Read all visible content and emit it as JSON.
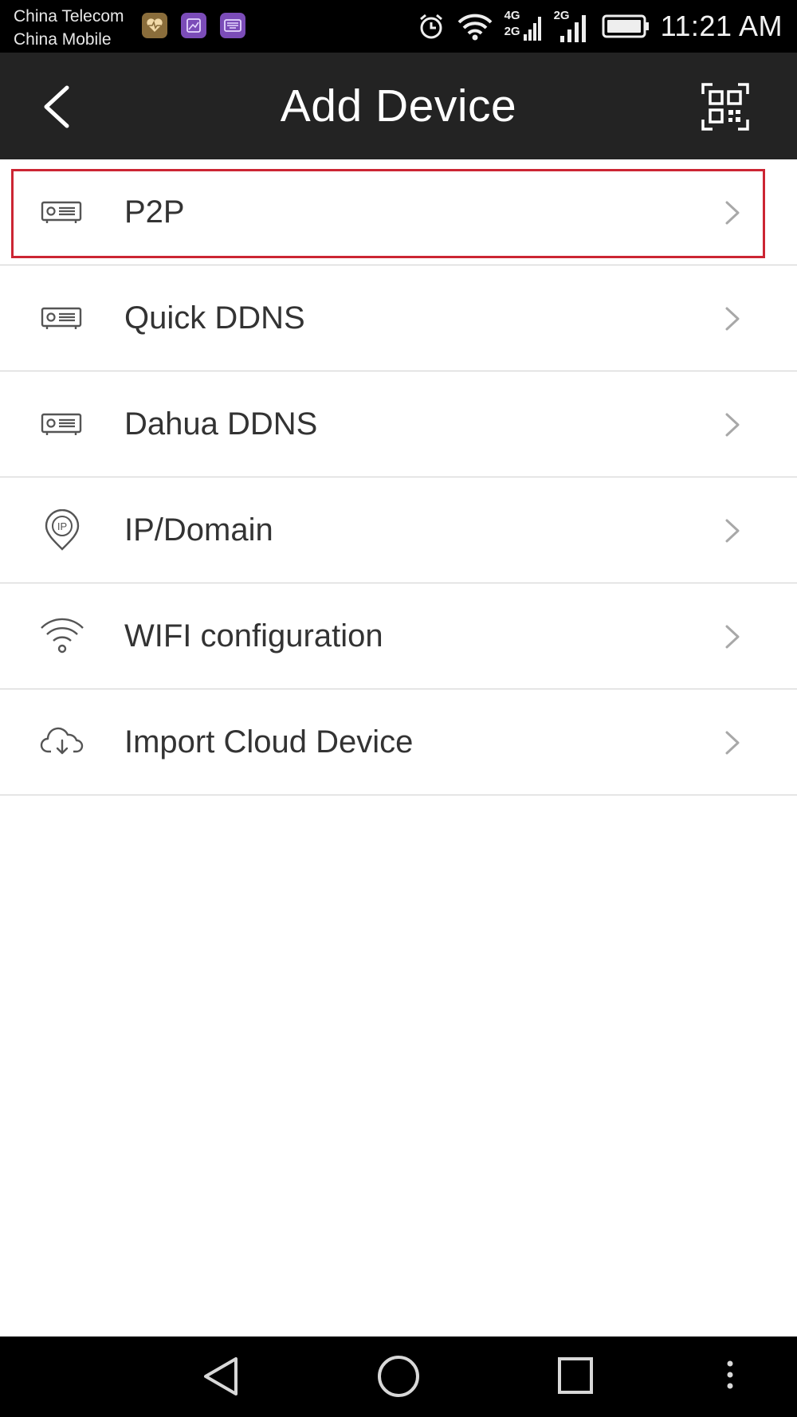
{
  "status_bar": {
    "carrier_1": "China Telecom",
    "carrier_2": "China Mobile",
    "network_1": "4G",
    "network_2": "2G",
    "network_3": "2G",
    "time": "11:21 AM"
  },
  "header": {
    "title": "Add Device"
  },
  "menu": {
    "items": [
      {
        "label": "P2P",
        "icon": "device-recorder-icon"
      },
      {
        "label": "Quick DDNS",
        "icon": "device-recorder-icon"
      },
      {
        "label": "Dahua DDNS",
        "icon": "device-recorder-icon"
      },
      {
        "label": "IP/Domain",
        "icon": "ip-pin-icon",
        "icon_text": "IP"
      },
      {
        "label": "WIFI configuration",
        "icon": "wifi-icon"
      },
      {
        "label": "Import Cloud Device",
        "icon": "cloud-download-icon"
      }
    ],
    "highlighted_item": "P2P"
  },
  "colors": {
    "status_bar": "#000000",
    "app_bar": "#232323",
    "highlight_border": "#cc2533",
    "row_text": "#333333",
    "divider": "#cfcfcf"
  }
}
